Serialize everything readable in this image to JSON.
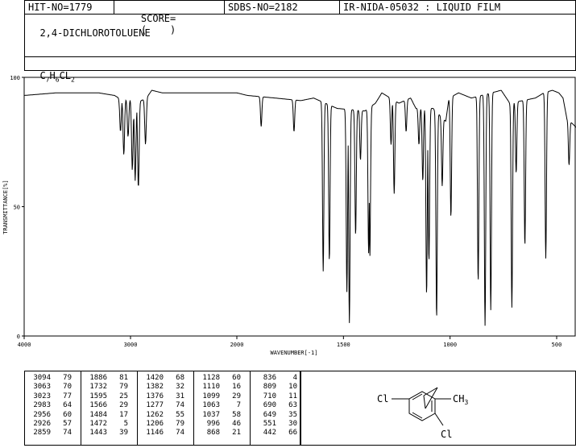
{
  "header": {
    "hit_no": "HIT-NO=1779",
    "score_label": "SCORE=",
    "score_value": "(    )",
    "sdbs_no": "SDBS-NO=2182",
    "ir_nida": "IR-NIDA-05032 : LIQUID FILM"
  },
  "compound": {
    "name": "2,4-DICHLOROTOLUENE",
    "formula": {
      "c": "C",
      "c_sub": "7",
      "h": "H",
      "h_sub": "6",
      "cl": "CL",
      "cl_sub": "2"
    }
  },
  "structure": {
    "left_label": "Cl",
    "methyl_label": "CH",
    "methyl_sub": "3",
    "bottom_label": "Cl"
  },
  "peak_table": [
    [
      [
        3094,
        79
      ],
      [
        3063,
        70
      ],
      [
        3023,
        77
      ],
      [
        2983,
        64
      ],
      [
        2956,
        60
      ],
      [
        2926,
        57
      ],
      [
        2859,
        74
      ]
    ],
    [
      [
        1886,
        81
      ],
      [
        1732,
        79
      ],
      [
        1595,
        25
      ],
      [
        1566,
        29
      ],
      [
        1484,
        17
      ],
      [
        1472,
        5
      ],
      [
        1443,
        39
      ]
    ],
    [
      [
        1420,
        68
      ],
      [
        1382,
        32
      ],
      [
        1376,
        31
      ],
      [
        1277,
        74
      ],
      [
        1262,
        55
      ],
      [
        1206,
        79
      ],
      [
        1146,
        74
      ]
    ],
    [
      [
        1128,
        60
      ],
      [
        1110,
        16
      ],
      [
        1099,
        29
      ],
      [
        1063,
        7
      ],
      [
        1037,
        58
      ],
      [
        996,
        46
      ],
      [
        868,
        21
      ]
    ],
    [
      [
        836,
        4
      ],
      [
        809,
        10
      ],
      [
        710,
        11
      ],
      [
        690,
        63
      ],
      [
        649,
        35
      ],
      [
        551,
        30
      ],
      [
        442,
        66
      ]
    ]
  ],
  "chart_data": {
    "type": "line",
    "title": "",
    "xlabel": "WAVENUMBER[-1]",
    "ylabel": "TRANSMITTANCE[%]",
    "xlim": [
      4000,
      400
    ],
    "ylim": [
      0,
      100
    ],
    "xticks": [
      4000,
      3000,
      2000,
      1500,
      1000,
      500
    ],
    "yticks": [
      0,
      50,
      100
    ],
    "baseline": [
      [
        4000,
        93
      ],
      [
        3700,
        94
      ],
      [
        3500,
        94
      ],
      [
        3300,
        94
      ],
      [
        3150,
        93
      ],
      [
        3110,
        92
      ],
      [
        2900,
        91
      ],
      [
        2850,
        92
      ],
      [
        2800,
        95
      ],
      [
        2700,
        94
      ],
      [
        2500,
        94
      ],
      [
        2300,
        94
      ],
      [
        2100,
        94
      ],
      [
        2000,
        94
      ],
      [
        1950,
        93
      ],
      [
        1820,
        92
      ],
      [
        1700,
        91
      ],
      [
        1640,
        92
      ],
      [
        1530,
        88
      ],
      [
        1400,
        87
      ],
      [
        1350,
        90
      ],
      [
        1320,
        94
      ],
      [
        1240,
        90
      ],
      [
        1185,
        92
      ],
      [
        1160,
        88
      ],
      [
        1080,
        88
      ],
      [
        1020,
        83
      ],
      [
        1005,
        92
      ],
      [
        960,
        94
      ],
      [
        900,
        92
      ],
      [
        760,
        95
      ],
      [
        720,
        90
      ],
      [
        600,
        92
      ],
      [
        560,
        94
      ],
      [
        520,
        95
      ],
      [
        490,
        94
      ],
      [
        470,
        92
      ],
      [
        452,
        84
      ],
      [
        425,
        82
      ],
      [
        400,
        80
      ]
    ],
    "peaks": [
      [
        3094,
        79
      ],
      [
        3063,
        70
      ],
      [
        3023,
        77
      ],
      [
        2983,
        64
      ],
      [
        2956,
        60
      ],
      [
        2926,
        57
      ],
      [
        2859,
        74
      ],
      [
        1886,
        81
      ],
      [
        1732,
        79
      ],
      [
        1595,
        25
      ],
      [
        1566,
        29
      ],
      [
        1484,
        17
      ],
      [
        1472,
        5
      ],
      [
        1443,
        39
      ],
      [
        1420,
        68
      ],
      [
        1382,
        32
      ],
      [
        1376,
        31
      ],
      [
        1277,
        74
      ],
      [
        1262,
        55
      ],
      [
        1206,
        79
      ],
      [
        1146,
        74
      ],
      [
        1128,
        60
      ],
      [
        1110,
        16
      ],
      [
        1099,
        29
      ],
      [
        1063,
        7
      ],
      [
        1037,
        58
      ],
      [
        996,
        46
      ],
      [
        868,
        21
      ],
      [
        836,
        4
      ],
      [
        809,
        10
      ],
      [
        710,
        11
      ],
      [
        690,
        63
      ],
      [
        649,
        35
      ],
      [
        551,
        30
      ],
      [
        442,
        66
      ]
    ]
  }
}
